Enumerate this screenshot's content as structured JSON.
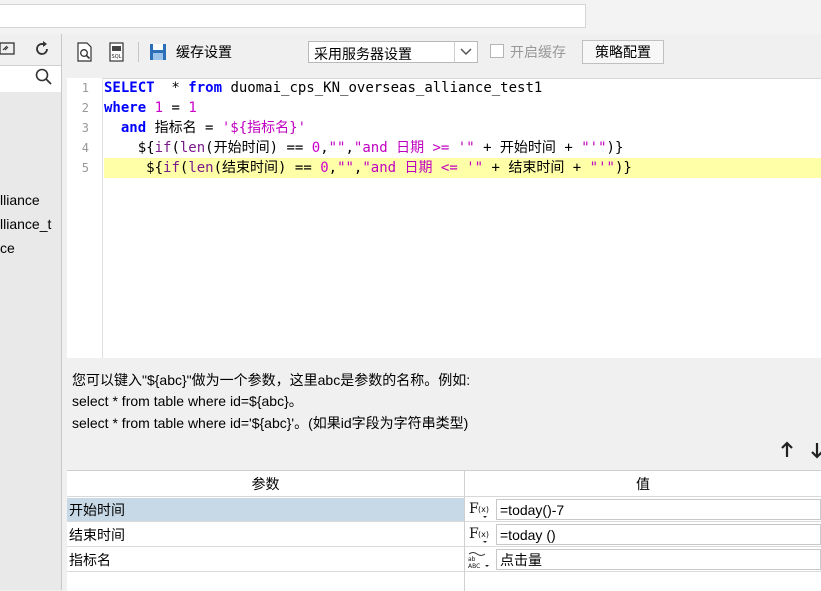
{
  "top": {
    "address_value": ""
  },
  "left_panel": {
    "items": [
      "lliance",
      "lliance_t",
      "ce"
    ]
  },
  "toolbar": {
    "cache_label": "缓存设置",
    "cache_select_value": "采用服务器设置",
    "enable_cache_label": "开启缓存",
    "policy_button": "策略配置"
  },
  "editor": {
    "line_numbers": [
      "1",
      "2",
      "3",
      "4",
      "5"
    ],
    "lines": [
      "SELECT  * from duomai_cps_KN_overseas_alliance_test1",
      "where 1 = 1",
      "  and 指标名 = '${指标名}'",
      "    ${if(len(开始时间) == 0,\"\",\"and 日期 >= '\" + 开始时间 + \"'\")}",
      "     ${if(len(结束时间) == 0,\"\",\"and 日期 <= '\" + 结束时间 + \"'\")}"
    ]
  },
  "help": {
    "line1": "您可以键入\"${abc}\"做为一个参数，这里abc是参数的名称。例如:",
    "line2": "select * from table where id=${abc}。",
    "line3": "select * from table where id='${abc}'。(如果id字段为字符串类型)"
  },
  "params": {
    "header_name": "参数",
    "header_value": "值",
    "rows": [
      {
        "name": "开始时间",
        "value": "=today()-7",
        "icon": "formula-icon",
        "selected": true
      },
      {
        "name": "结束时间",
        "value": "=today ()",
        "icon": "formula-icon",
        "selected": false
      },
      {
        "name": "指标名",
        "value": "点击量",
        "icon": "text-type-icon",
        "selected": false
      }
    ]
  },
  "colors": {
    "keyword": "#0000ff",
    "string": "#c000c0",
    "highlight_line": "#ffffa8",
    "selected_row": "#c7d8e6"
  }
}
